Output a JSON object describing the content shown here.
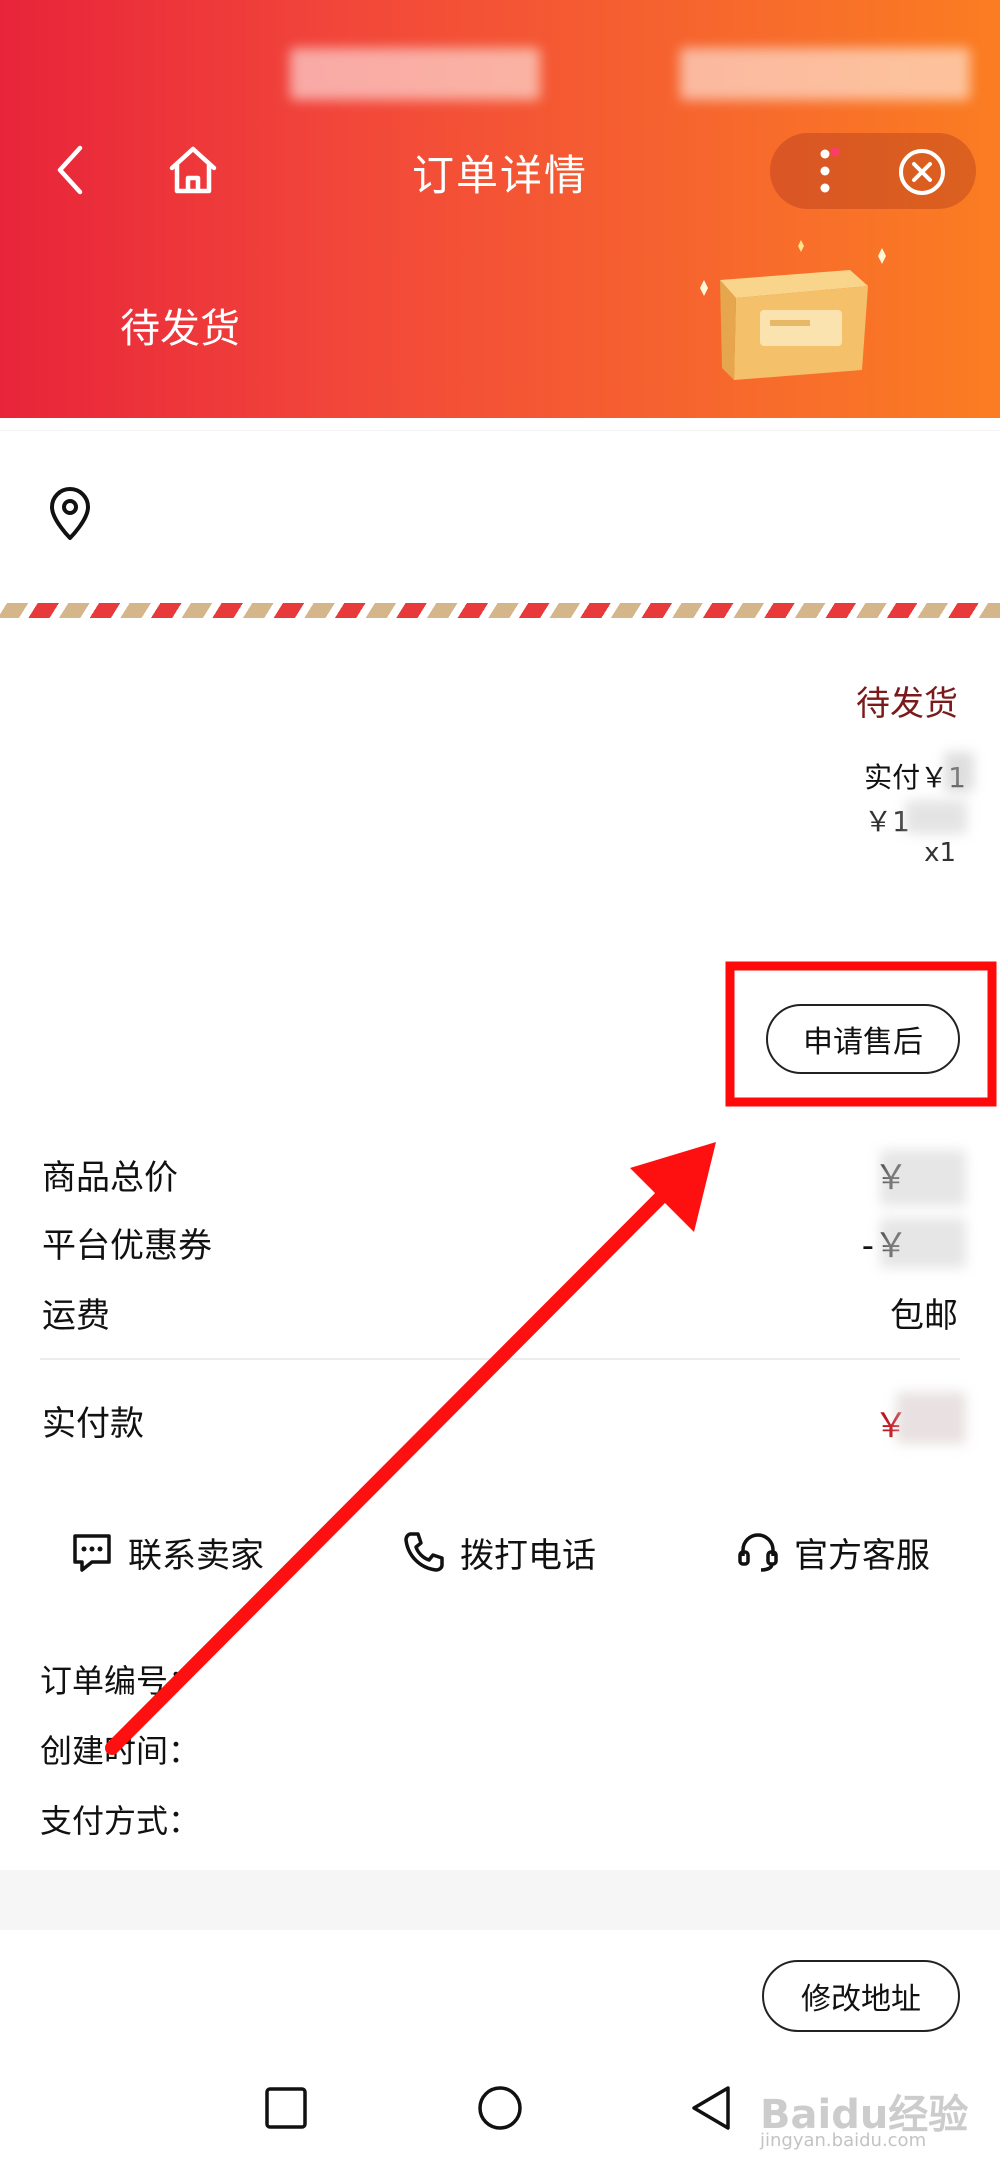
{
  "header": {
    "title": "订单详情",
    "status": "待发货",
    "colors": {
      "start": "#e8243a",
      "end": "#fb7d22"
    }
  },
  "icons": {
    "back": "chevron-left-icon",
    "home": "home-icon",
    "more": "more-dots-icon",
    "close": "close-circle-icon",
    "location": "location-pin-icon",
    "package": "package-box-icon"
  },
  "order": {
    "status": "待发货",
    "paid_prefix": "实付￥1",
    "unit_price": "￥1",
    "quantity": "x1",
    "after_sale_button": "申请售后"
  },
  "price_summary": {
    "goods_total_label": "商品总价",
    "goods_total_value": "￥",
    "coupon_label": "平台优惠券",
    "coupon_value": "-￥",
    "shipping_label": "运费",
    "shipping_value": "包邮",
    "paid_label": "实付款",
    "paid_value": "￥"
  },
  "actions": {
    "contact_seller": "联系卖家",
    "call": "拨打电话",
    "service": "官方客服"
  },
  "order_info": {
    "order_no_label": "订单编号：",
    "created_label": "创建时间：",
    "pay_method_label": "支付方式："
  },
  "bottom": {
    "modify_address": "修改地址"
  },
  "watermark": {
    "brand": "Baidu经验",
    "site": "jingyan.baidu.com"
  }
}
